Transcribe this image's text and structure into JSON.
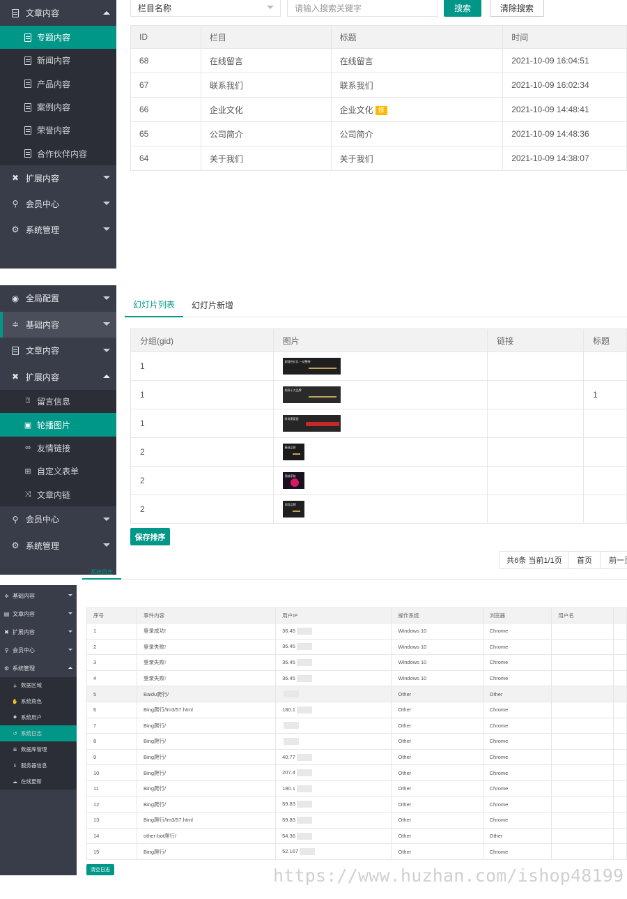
{
  "section1": {
    "sidebar": {
      "group_content": "文章内容",
      "items": [
        "专题内容",
        "新闻内容",
        "产品内容",
        "案例内容",
        "荣誉内容",
        "合作伙伴内容"
      ],
      "active_item": "专题内容",
      "group_ext": "扩展内容",
      "group_member": "会员中心",
      "group_system": "系统管理"
    },
    "filter": {
      "select_value": "栏目名称",
      "search_placeholder": "请输入搜索关键字",
      "search_label": "搜索",
      "clear_label": "清除搜索"
    },
    "table": {
      "headers": [
        "ID",
        "栏目",
        "标题",
        "时间"
      ],
      "rows": [
        {
          "id": "68",
          "column": "在线留言",
          "title": "在线留言",
          "badge": "",
          "time": "2021-10-09 16:04:51"
        },
        {
          "id": "67",
          "column": "联系我们",
          "title": "联系我们",
          "badge": "",
          "time": "2021-10-09 16:02:34"
        },
        {
          "id": "66",
          "column": "企业文化",
          "title": "企业文化",
          "badge": "修",
          "time": "2021-10-09 14:48:41"
        },
        {
          "id": "65",
          "column": "公司简介",
          "title": "公司简介",
          "badge": "",
          "time": "2021-10-09 14:48:36"
        },
        {
          "id": "64",
          "column": "关于我们",
          "title": "关于我们",
          "badge": "",
          "time": "2021-10-09 14:38:07"
        }
      ]
    }
  },
  "section2": {
    "sidebar": {
      "group_global": "全局配置",
      "group_basic": "基础内容",
      "group_content": "文章内容",
      "group_ext": "扩展内容",
      "items": [
        "留言信息",
        "轮播图片",
        "友情链接",
        "自定义表单",
        "文章内链"
      ],
      "active_item": "轮播图片",
      "group_member": "会员中心",
      "group_system": "系统管理"
    },
    "tabs": [
      "幻灯片列表",
      "幻灯片新增"
    ],
    "active_tab": "幻灯片列表",
    "table": {
      "headers": [
        "分组(gid)",
        "图片",
        "链接",
        "标题"
      ],
      "rows": [
        {
          "gid": "1",
          "thumb_color": "#1f1f1f",
          "thumb_text": "超强性价比 一站整装",
          "link": "",
          "title": ""
        },
        {
          "gid": "1",
          "thumb_color": "#2a2a2a",
          "thumb_text": "领导十大品牌",
          "link": "",
          "title": "1"
        },
        {
          "gid": "1",
          "thumb_color": "#262626",
          "thumb_text": "时尚潮家居",
          "link": "",
          "title": ""
        },
        {
          "gid": "2",
          "thumb_color": "#1b1b1b",
          "thumb_text": "精选品质",
          "link": "",
          "title": ""
        },
        {
          "gid": "2",
          "thumb_color": "#1a1020",
          "thumb_text": "潮流家装",
          "link": "",
          "title": ""
        },
        {
          "gid": "2",
          "thumb_color": "#1f1f1f",
          "thumb_text": "领导品牌",
          "link": "",
          "title": ""
        }
      ]
    },
    "save_label": "保存排序",
    "pager": {
      "summary": "共6条 当前1/1页",
      "first": "首页",
      "prev": "前一页"
    }
  },
  "section3": {
    "sidebar": {
      "group_basic": "基础内容",
      "group_content": "文章内容",
      "group_ext": "扩展内容",
      "group_member": "会员中心",
      "group_system": "系统管理",
      "items": [
        "数据区域",
        "系统角色",
        "系统用户",
        "系统日志",
        "数据库管理",
        "服务器信息",
        "在线更新"
      ],
      "active_item": "系统日志"
    },
    "tab": "系统日志",
    "table": {
      "headers": [
        "序号",
        "事件内容",
        "用户IP",
        "操作系统",
        "浏览器",
        "用户名"
      ],
      "rows": [
        {
          "no": "1",
          "event": "登录成功!",
          "ip": "36.45",
          "os": "Windows 10",
          "browser": "Chrome",
          "user": ""
        },
        {
          "no": "2",
          "event": "登录失败!",
          "ip": "36.45",
          "os": "Windows 10",
          "browser": "Chrome",
          "user": ""
        },
        {
          "no": "3",
          "event": "登录失败!",
          "ip": "36.45",
          "os": "Windows 10",
          "browser": "Chrome",
          "user": ""
        },
        {
          "no": "4",
          "event": "登录失败!",
          "ip": "36.45",
          "os": "Windows 10",
          "browser": "Chrome",
          "user": ""
        },
        {
          "no": "5",
          "event": "Baidu爬行/",
          "ip": "",
          "os": "Other",
          "browser": "Other",
          "user": ""
        },
        {
          "no": "6",
          "event": "Bing爬行/lm3/57.html",
          "ip": "180.1",
          "os": "Other",
          "browser": "Chrome",
          "user": ""
        },
        {
          "no": "7",
          "event": "Bing爬行/",
          "ip": "",
          "os": "Other",
          "browser": "Chrome",
          "user": ""
        },
        {
          "no": "8",
          "event": "Bing爬行/",
          "ip": "",
          "os": "Other",
          "browser": "Chrome",
          "user": ""
        },
        {
          "no": "9",
          "event": "Bing爬行/",
          "ip": "40.77",
          "os": "Other",
          "browser": "Chrome",
          "user": ""
        },
        {
          "no": "10",
          "event": "Bing爬行/",
          "ip": "207.4",
          "os": "Other",
          "browser": "Chrome",
          "user": ""
        },
        {
          "no": "11",
          "event": "Bing爬行/",
          "ip": "180.1",
          "os": "Other",
          "browser": "Chrome",
          "user": ""
        },
        {
          "no": "12",
          "event": "Bing爬行/",
          "ip": "59.83",
          "os": "Other",
          "browser": "Chrome",
          "user": ""
        },
        {
          "no": "13",
          "event": "Bing爬行/lm3/57.html",
          "ip": "59.83",
          "os": "Other",
          "browser": "Chrome",
          "user": ""
        },
        {
          "no": "14",
          "event": "other-bot爬行/",
          "ip": "54.36",
          "os": "Other",
          "browser": "Other",
          "user": ""
        },
        {
          "no": "15",
          "event": "Bing爬行/",
          "ip": "52.167",
          "os": "Other",
          "browser": "Chrome",
          "user": ""
        }
      ]
    },
    "clear_label": "清空日志"
  },
  "watermark": "https://www.huzhan.com/ishop48199",
  "colors": {
    "accent": "#009688",
    "sidebar_bg": "#393d49",
    "badge": "#ffb800"
  }
}
